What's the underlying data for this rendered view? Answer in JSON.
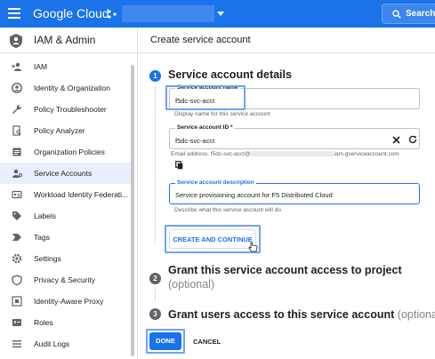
{
  "topbar": {
    "brand": "Google Cloud",
    "search_label": "Search",
    "bg_color": "#1a73e8"
  },
  "sidebar": {
    "title": "IAM & Admin",
    "items": [
      {
        "label": "IAM",
        "icon": "person-add-icon"
      },
      {
        "label": "Identity & Organization",
        "icon": "account-circle-icon"
      },
      {
        "label": "Policy Troubleshooter",
        "icon": "wrench-icon"
      },
      {
        "label": "Policy Analyzer",
        "icon": "document-search-icon"
      },
      {
        "label": "Organization Policies",
        "icon": "list-box-icon"
      },
      {
        "label": "Service Accounts",
        "icon": "service-account-icon",
        "active": true
      },
      {
        "label": "Workload Identity Federati...",
        "icon": "id-card-icon"
      },
      {
        "label": "Labels",
        "icon": "label-tag-icon"
      },
      {
        "label": "Tags",
        "icon": "tag-chevron-icon"
      },
      {
        "label": "Settings",
        "icon": "gear-icon"
      },
      {
        "label": "Privacy & Security",
        "icon": "shield-icon"
      },
      {
        "label": "Identity-Aware Proxy",
        "icon": "proxy-icon"
      },
      {
        "label": "Roles",
        "icon": "roles-icon"
      },
      {
        "label": "Audit Logs",
        "icon": "list-lines-icon"
      }
    ]
  },
  "main": {
    "title": "Create service account",
    "step1": {
      "number": "1",
      "title": "Service account details",
      "name_label": "Service account name",
      "name_value": "f5dc-svc-acct",
      "name_hint": "Display name for this service account",
      "id_label": "Service account ID *",
      "id_value": "f5dc-svc-acct",
      "email_prefix": "Email address: f5dc-svc-acct@",
      "email_suffix": ".iam.gserviceaccount.com",
      "desc_label": "Service account description",
      "desc_value": "Service provisioning account for F5 Distributed Cloud",
      "desc_hint": "Describe what this service account will do",
      "create_continue": "CREATE AND CONTINUE"
    },
    "step2": {
      "number": "2",
      "title": "Grant this service account access to project",
      "optional": "(optional)"
    },
    "step3": {
      "number": "3",
      "title": "Grant users access to this service account",
      "optional": "(optional)"
    },
    "done_label": "DONE",
    "cancel_label": "CANCEL"
  }
}
